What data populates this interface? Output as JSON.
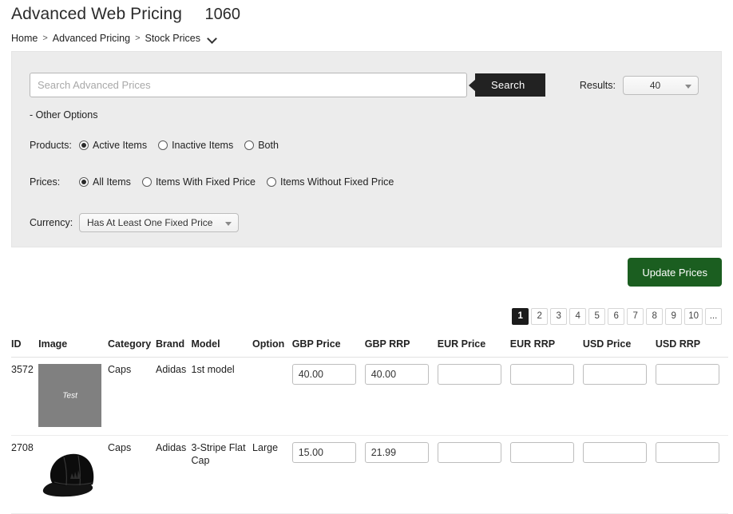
{
  "header": {
    "title": "Advanced Web Pricing",
    "count": "1060",
    "breadcrumb": {
      "items": [
        "Home",
        "Advanced Pricing",
        "Stock Prices"
      ],
      "separator": ">"
    }
  },
  "filters": {
    "search": {
      "placeholder": "Search Advanced Prices",
      "value": "",
      "button_label": "Search"
    },
    "results": {
      "label": "Results:",
      "value": "40"
    },
    "other_options_label": "- Other Options",
    "products": {
      "label": "Products:",
      "options": [
        {
          "label": "Active Items",
          "checked": true
        },
        {
          "label": "Inactive Items",
          "checked": false
        },
        {
          "label": "Both",
          "checked": false
        }
      ]
    },
    "prices": {
      "label": "Prices:",
      "options": [
        {
          "label": "All Items",
          "checked": true
        },
        {
          "label": "Items With Fixed Price",
          "checked": false
        },
        {
          "label": "Items Without Fixed Price",
          "checked": false
        }
      ]
    },
    "currency": {
      "label": "Currency:",
      "value": "Has At Least One Fixed Price"
    }
  },
  "actions": {
    "update_prices_label": "Update Prices",
    "update_prices_color": "#1b5e20"
  },
  "pagination": {
    "pages": [
      "1",
      "2",
      "3",
      "4",
      "5",
      "6",
      "7",
      "8",
      "9",
      "10",
      "..."
    ],
    "active_index": 0
  },
  "table": {
    "columns": [
      "ID",
      "Image",
      "Category",
      "Brand",
      "Model",
      "Option",
      "GBP Price",
      "GBP RRP",
      "EUR Price",
      "EUR RRP",
      "USD Price",
      "USD RRP"
    ],
    "rows": [
      {
        "id": "3572",
        "image_kind": "placeholder",
        "image_alt": "Test",
        "category": "Caps",
        "brand": "Adidas",
        "model": "1st model",
        "option": "",
        "gbp_price": "40.00",
        "gbp_rrp": "40.00",
        "eur_price": "",
        "eur_rrp": "",
        "usd_price": "",
        "usd_rrp": ""
      },
      {
        "id": "2708",
        "image_kind": "photo",
        "image_alt": "black adidas flat cap",
        "category": "Caps",
        "brand": "Adidas",
        "model": "3-Stripe Flat Cap",
        "option": "Large",
        "gbp_price": "15.00",
        "gbp_rrp": "21.99",
        "eur_price": "",
        "eur_rrp": "",
        "usd_price": "",
        "usd_rrp": ""
      }
    ]
  }
}
